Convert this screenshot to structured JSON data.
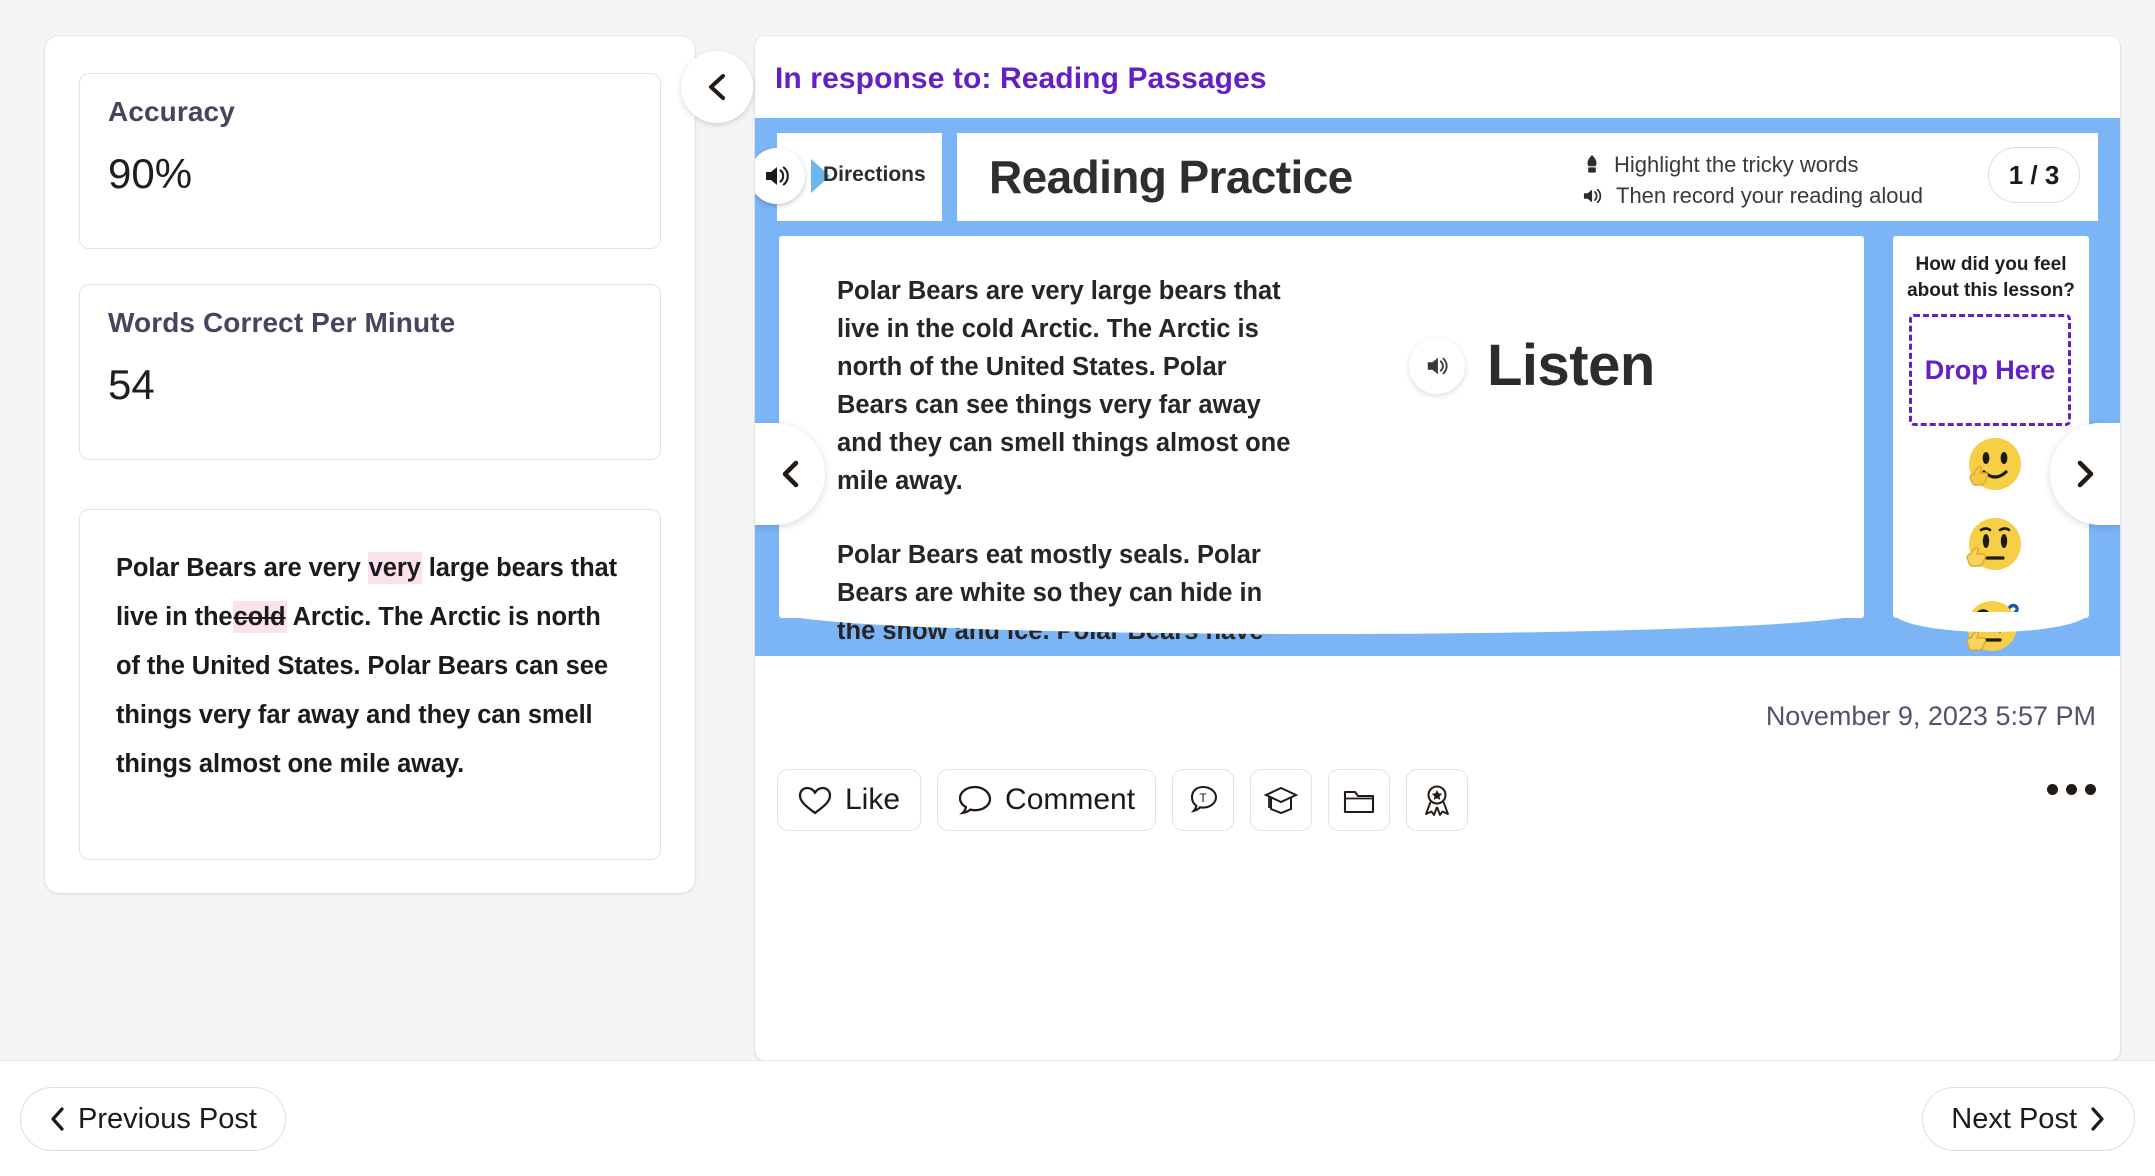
{
  "left_panel": {
    "stats": [
      {
        "label": "Accuracy",
        "value": "90%"
      },
      {
        "label": "Words Correct Per Minute",
        "value": "54"
      }
    ],
    "transcript": {
      "segments": [
        {
          "text": "Polar Bears are very ",
          "mark": "none"
        },
        {
          "text": "very",
          "mark": "insertion"
        },
        {
          "text": " large bears that live in the",
          "mark": "none"
        },
        {
          "text": "cold",
          "mark": "omission"
        },
        {
          "text": " Arctic. The Arctic is north of the United States. Polar Bears can see things very far away and they can smell things almost one mile away.",
          "mark": "none"
        }
      ]
    },
    "collapse_icon": "chevron-left-icon"
  },
  "right_panel": {
    "response_title": "In response to: Reading Passages",
    "activity": {
      "directions_label": "Directions",
      "title": "Reading Practice",
      "instructions": [
        {
          "icon": "highlighter-icon",
          "text": "Highlight the tricky words"
        },
        {
          "icon": "speaker-icon",
          "text": "Then record your reading aloud"
        }
      ],
      "page_indicator": "1 / 3",
      "passage_paragraphs": [
        "Polar Bears are very large bears that live in the cold Arctic. The Arctic is north of the United States. Polar Bears can see things very far away and they can smell things almost one mile away.",
        "Polar Bears eat mostly seals. Polar Bears are white so they can hide in the snow and ice. Polar Bears have large feet and thick claws that make it easier for them to walk on the ice. They have two layers of fur and a thick coat of blubber that keeps them warm."
      ],
      "listen_label": "Listen",
      "feedback": {
        "question": "How did you feel about this lesson?",
        "drop_label": "Drop Here",
        "emojis": [
          "thumbs-up-smiley-emoji",
          "neutral-thinking-emoji",
          "confused-question-emoji"
        ]
      },
      "card_color": "#7cb5f5",
      "accent_color": "#6320c4"
    },
    "timestamp": "November 9, 2023 5:57 PM",
    "actions": [
      {
        "name": "like-button",
        "icon": "heart-icon",
        "label": "Like"
      },
      {
        "name": "comment-button",
        "icon": "speech-bubble-icon",
        "label": "Comment"
      },
      {
        "name": "text-comment-button",
        "icon": "text-bubble-icon",
        "label": ""
      },
      {
        "name": "assign-button",
        "icon": "graduation-cap-icon",
        "label": ""
      },
      {
        "name": "folder-button",
        "icon": "folder-icon",
        "label": ""
      },
      {
        "name": "award-button",
        "icon": "award-ribbon-icon",
        "label": ""
      }
    ],
    "more_label": "..."
  },
  "bottom_bar": {
    "previous_label": "Previous Post",
    "next_label": "Next Post"
  }
}
